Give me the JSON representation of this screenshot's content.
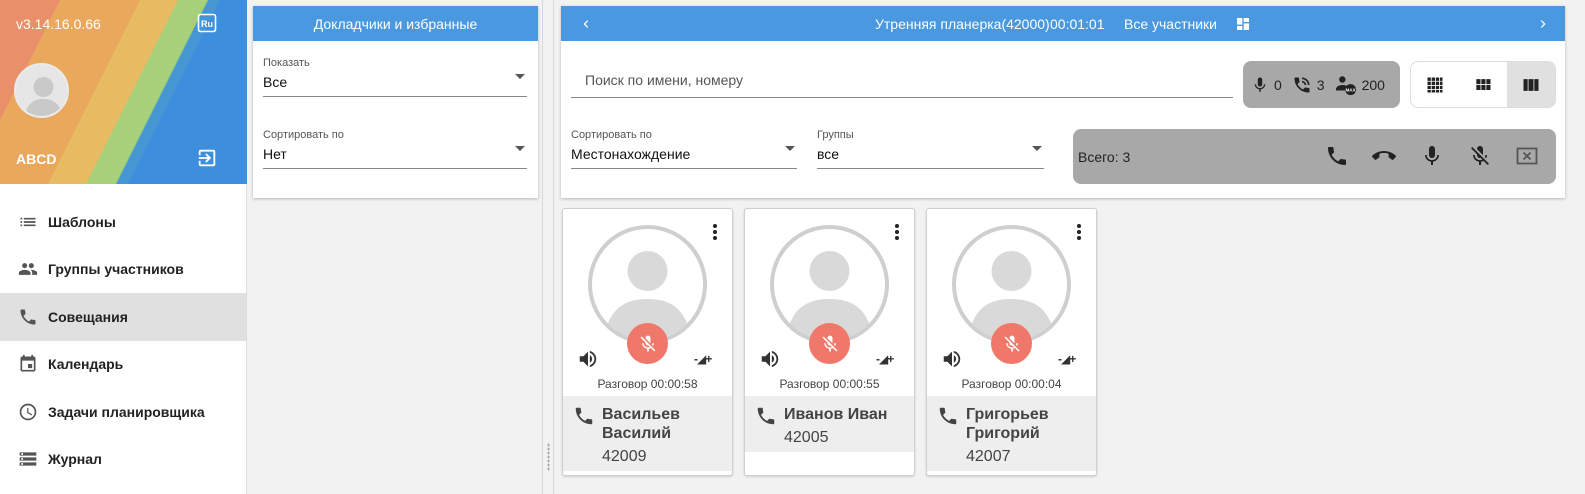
{
  "app": {
    "version": "v3.14.16.0.66",
    "lang": "Ru",
    "user": "ABCD"
  },
  "nav": [
    {
      "label": "Шаблоны",
      "icon": "list-icon",
      "active": false
    },
    {
      "label": "Группы участников",
      "icon": "people-icon",
      "active": false
    },
    {
      "label": "Совещания",
      "icon": "phone-icon",
      "active": true
    },
    {
      "label": "Календарь",
      "icon": "calendar-icon",
      "active": false
    },
    {
      "label": "Задачи планировщика",
      "icon": "clock-icon",
      "active": false
    },
    {
      "label": "Журнал",
      "icon": "journal-icon",
      "active": false
    }
  ],
  "speakers_panel": {
    "title": "Докладчики и избранные",
    "show_label": "Показать",
    "show_value": "Все",
    "sort_label": "Сортировать по",
    "sort_value": "Нет"
  },
  "conference": {
    "title": "Утренняя планерка(42000)",
    "timer": "00:01:01",
    "filter": "Все участники",
    "search_placeholder": "Поиск по имени, номеру",
    "counters": {
      "mic": "0",
      "calls": "3",
      "max": "200"
    },
    "sort_label": "Сортировать по",
    "sort_value": "Местонахождение",
    "groups_label": "Группы",
    "groups_value": "все",
    "total": "Всего: 3"
  },
  "participants": [
    {
      "name": "Васильев Василий",
      "number": "42009",
      "status": "Разговор 00:00:58",
      "volume": "-◢+"
    },
    {
      "name": "Иванов Иван",
      "number": "42005",
      "status": "Разговор 00:00:55",
      "volume": "-◢+"
    },
    {
      "name": "Григорьев Григорий",
      "number": "42007",
      "status": "Разговор 00:00:04",
      "volume": "-◢+"
    }
  ],
  "colors": {
    "primary": "#4a98e0",
    "mute": "#f0786a",
    "toolbar_gray": "#a8a8a8"
  }
}
